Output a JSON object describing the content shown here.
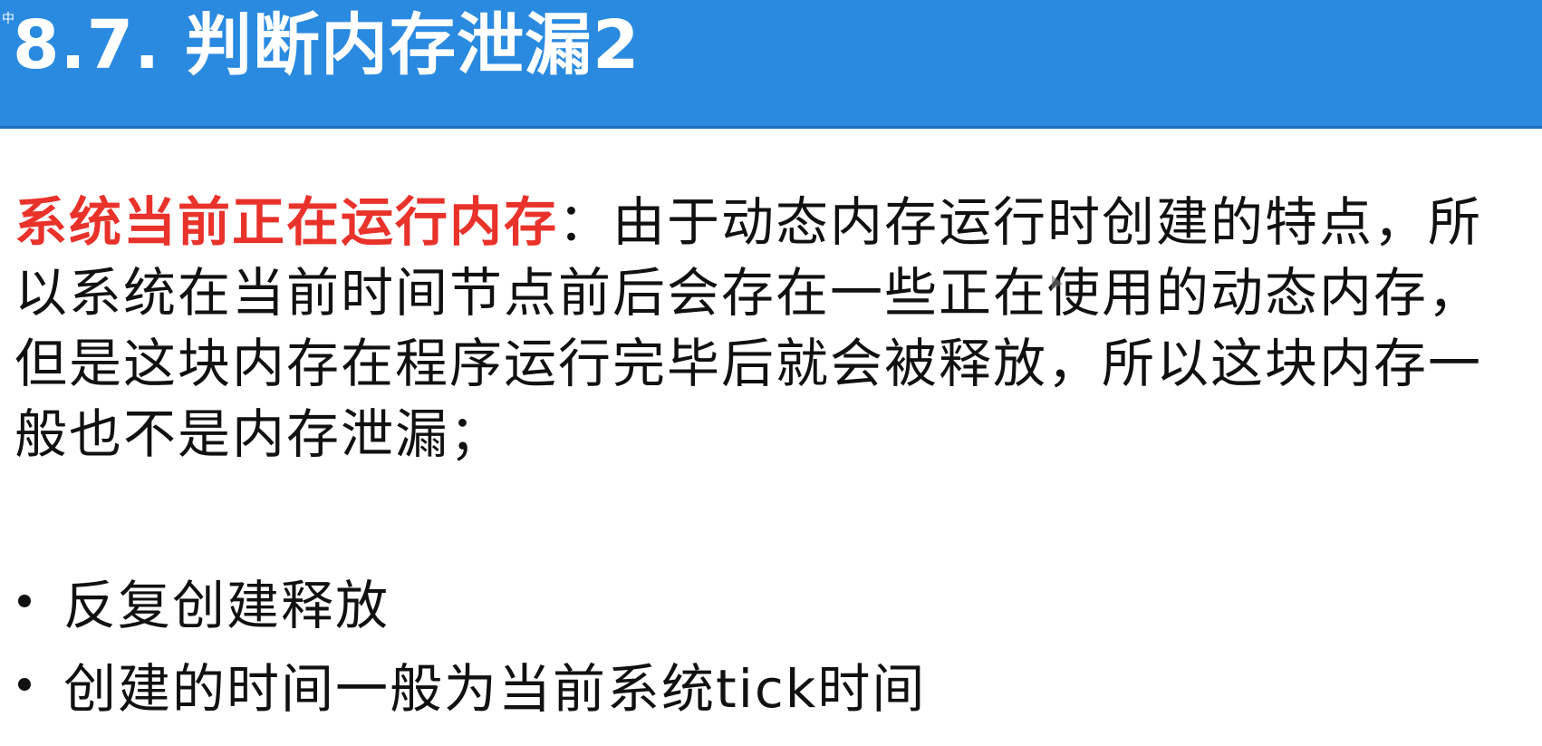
{
  "header": {
    "ime_indicator": "中",
    "title": "8.7. 判断内存泄漏2"
  },
  "paragraph": {
    "highlight": "系统当前正在运行内存",
    "separator": "：",
    "body": "由于动态内存运行时创建的特点，所以系统在当前时间节点前后会存在一些正在使用的动态内存，但是这块内存在程序运行完毕后就会被释放，所以这块内存一般也不是内存泄漏；"
  },
  "bullets": [
    {
      "text": "反复创建释放"
    },
    {
      "text": "创建的时间一般为当前系统tick时间"
    }
  ],
  "colors": {
    "header_background": "#2a8ae0",
    "highlight_text": "#e8322a"
  },
  "icons": {
    "cursor": "mouse-pointer-icon"
  }
}
